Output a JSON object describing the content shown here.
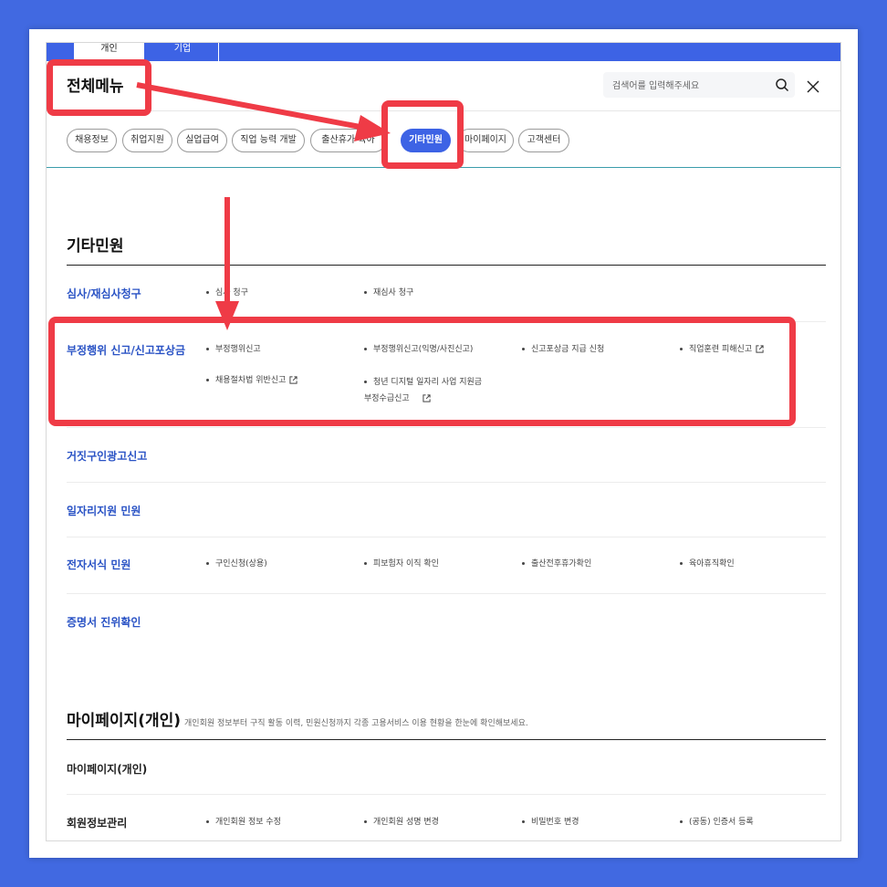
{
  "top_tabs": {
    "person": "개인",
    "company": "기업"
  },
  "menu_title": "전체메뉴",
  "search": {
    "placeholder": "검색어를 입력해주세요"
  },
  "categories": [
    "채용정보",
    "취업지원",
    "실업급여",
    "직업 능력 개발",
    "출산휴가 육아",
    "기타민원",
    "마이페이지",
    "고객센터"
  ],
  "active_category": "기타민원",
  "sections": {
    "etc": {
      "title": "기타민원",
      "rows": {
        "review": {
          "label": "심사/재심사청구",
          "links": [
            "심사 청구",
            "재심사 청구"
          ]
        },
        "report": {
          "label": "부정행위 신고/신고포상금",
          "links": [
            "부정행위신고",
            "부정행위신고(익명/사진신고)",
            "신고포상금 지급 신청",
            "직업훈련 피해신고",
            "채용절차법 위반신고",
            "청년 디지털 일자리 사업 지원금 부정수급신고"
          ]
        },
        "fake_ad": {
          "label": "거짓구인광고신고"
        },
        "job_support": {
          "label": "일자리지원 민원"
        },
        "eform": {
          "label": "전자서식 민원",
          "links": [
            "구인신청(상용)",
            "피보험자 이직 확인",
            "출산전후휴가확인",
            "육아휴직확인"
          ]
        },
        "cert": {
          "label": "증명서 진위확인"
        }
      }
    },
    "mypage": {
      "title": "마이페이지(개인)",
      "description": "개인회원 정보부터 구직 활동 이력, 민원신청까지 각종 고용서비스 이용 현황을 한눈에 확인해보세요.",
      "rows": {
        "mypage": {
          "label": "마이페이지(개인)"
        },
        "member": {
          "label": "회원정보관리",
          "links": [
            "개인회원 정보 수정",
            "개인회원 성명 변경",
            "비밀번호 변경",
            "(공동) 인증서 등록"
          ]
        }
      }
    }
  },
  "colors": {
    "page_bg": "#4169e1",
    "accent": "#3d63e5",
    "annotation": "#ef3b46",
    "link_blue": "#2a53c5"
  }
}
